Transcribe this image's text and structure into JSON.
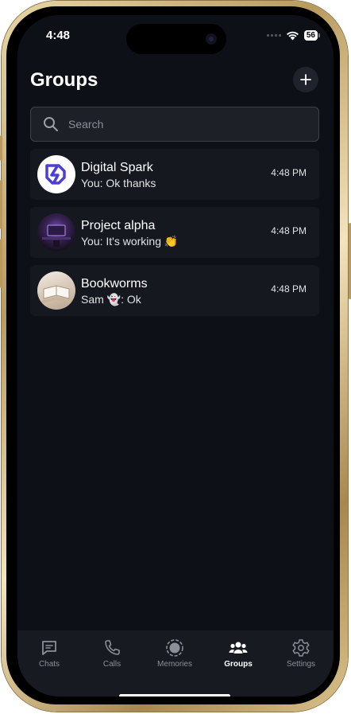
{
  "status_bar": {
    "time": "4:48",
    "battery": "56"
  },
  "header": {
    "title": "Groups"
  },
  "search": {
    "placeholder": "Search"
  },
  "groups": [
    {
      "name": "Digital Spark",
      "last_message": "You: Ok thanks",
      "time": "4:48 PM",
      "avatar": "digital-spark-logo"
    },
    {
      "name": "Project alpha",
      "last_message": "You: It's working 👏",
      "time": "4:48 PM",
      "avatar": "project-alpha-photo"
    },
    {
      "name": "Bookworms",
      "last_message": "Sam 👻: Ok",
      "time": "4:48 PM",
      "avatar": "bookworms-photo"
    }
  ],
  "tabs": [
    {
      "label": "Chats",
      "icon": "chat-icon"
    },
    {
      "label": "Calls",
      "icon": "phone-icon"
    },
    {
      "label": "Memories",
      "icon": "memories-icon"
    },
    {
      "label": "Groups",
      "icon": "groups-icon",
      "active": true
    },
    {
      "label": "Settings",
      "icon": "gear-icon"
    }
  ],
  "colors": {
    "background": "#0d1017",
    "card": "#16181f",
    "tabbar": "#171a21",
    "accent_logo": "#4b3fd6"
  }
}
